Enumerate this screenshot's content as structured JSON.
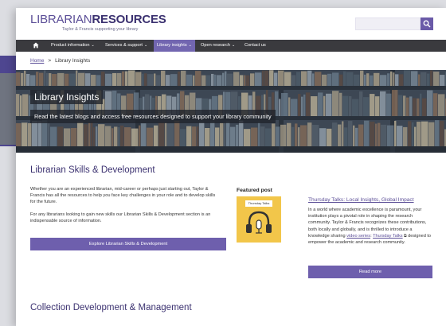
{
  "header": {
    "logo_part1": "LIBRARIAN",
    "logo_part2": "RESOURCES",
    "tagline": "Taylor & Francis supporting your library"
  },
  "nav": {
    "items": [
      {
        "label": "Product information",
        "has_dropdown": true
      },
      {
        "label": "Services & support",
        "has_dropdown": true
      },
      {
        "label": "Library insights",
        "has_dropdown": true,
        "active": true
      },
      {
        "label": "Open research",
        "has_dropdown": true
      },
      {
        "label": "Contact us",
        "has_dropdown": false
      }
    ],
    "home_icon": "home-icon",
    "dropdown_icon": "chevron-down-icon"
  },
  "breadcrumb": {
    "home": "Home",
    "separator": ">",
    "current": "Library Insights"
  },
  "hero": {
    "title": "Library Insights",
    "subtitle": "Read the latest blogs and access free resources designed to support your library community"
  },
  "skills": {
    "title": "Librarian Skills & Development",
    "para1": "Whether you are an experienced librarian, mid-career or perhaps just starting out, Taylor & Francis has all the resources to help you face key challenges in your role and to develop skills for the future.",
    "para2": "For any librarians looking to gain new skills our Librarian Skills & Development section is an indispensable source of information.",
    "button": "Explore Librarian Skills & Development"
  },
  "featured": {
    "label": "Featured post",
    "thumb_label": "Thursday Talks",
    "post_title": "Thursday Talks: Local Insights, Global Impact",
    "post_text_before": "In a world where academic excellence is paramount, your institution plays a pivotal role in shaping the research community. Taylor & Francis recognizes these contributions, both locally and globally, and is thrilled to introduce a knowledge sharing ",
    "post_link1": "video series",
    "post_link2": "Thursday Talks",
    "post_text_after": " designed to empower the academic and research community.",
    "button": "Read more"
  },
  "collection": {
    "title": "Collection Development & Management"
  },
  "colors": {
    "brand_purple": "#5b4e97",
    "nav_bg": "#3a3a3e",
    "active_tab": "#7266b0",
    "button": "#6e5fad",
    "thumb_yellow": "#f2c64a"
  }
}
